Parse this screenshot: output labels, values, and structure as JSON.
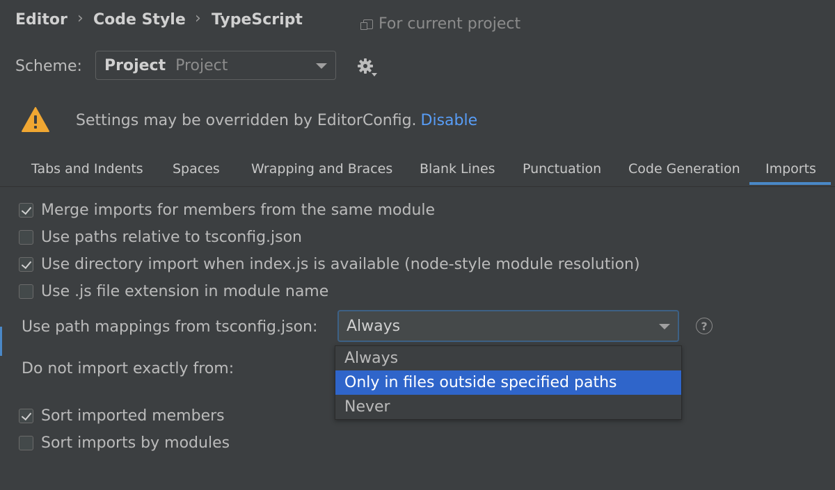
{
  "breadcrumb": {
    "items": [
      "Editor",
      "Code Style",
      "TypeScript"
    ],
    "separator": "›",
    "scope_label": "For current project"
  },
  "scheme": {
    "label": "Scheme:",
    "name": "Project",
    "scope": "Project"
  },
  "warning": {
    "text": "Settings may be overridden by EditorConfig.",
    "link": "Disable"
  },
  "tabs": {
    "items": [
      "Tabs and Indents",
      "Spaces",
      "Wrapping and Braces",
      "Blank Lines",
      "Punctuation",
      "Code Generation",
      "Imports"
    ],
    "active": "Imports"
  },
  "options": [
    {
      "label": "Merge imports for members from the same module",
      "checked": true
    },
    {
      "label": "Use paths relative to tsconfig.json",
      "checked": false
    },
    {
      "label": "Use directory import when index.js is available (node-style module resolution)",
      "checked": true
    },
    {
      "label": "Use .js file extension in module name",
      "checked": false
    }
  ],
  "path_mappings": {
    "label": "Use path mappings from tsconfig.json:",
    "value": "Always",
    "help": "?",
    "dropdown_options": [
      "Always",
      "Only in files outside specified paths",
      "Never"
    ],
    "highlighted_option": "Only in files outside specified paths"
  },
  "do_not_import": {
    "label": "Do not import exactly from:"
  },
  "sort_options": [
    {
      "label": "Sort imported members",
      "checked": true
    },
    {
      "label": "Sort imports by modules",
      "checked": false
    }
  ],
  "colors": {
    "background": "#3c3f41",
    "accent": "#4a88c7",
    "link": "#589df6",
    "selection": "#2f65ca",
    "warning": "#f0a732"
  }
}
